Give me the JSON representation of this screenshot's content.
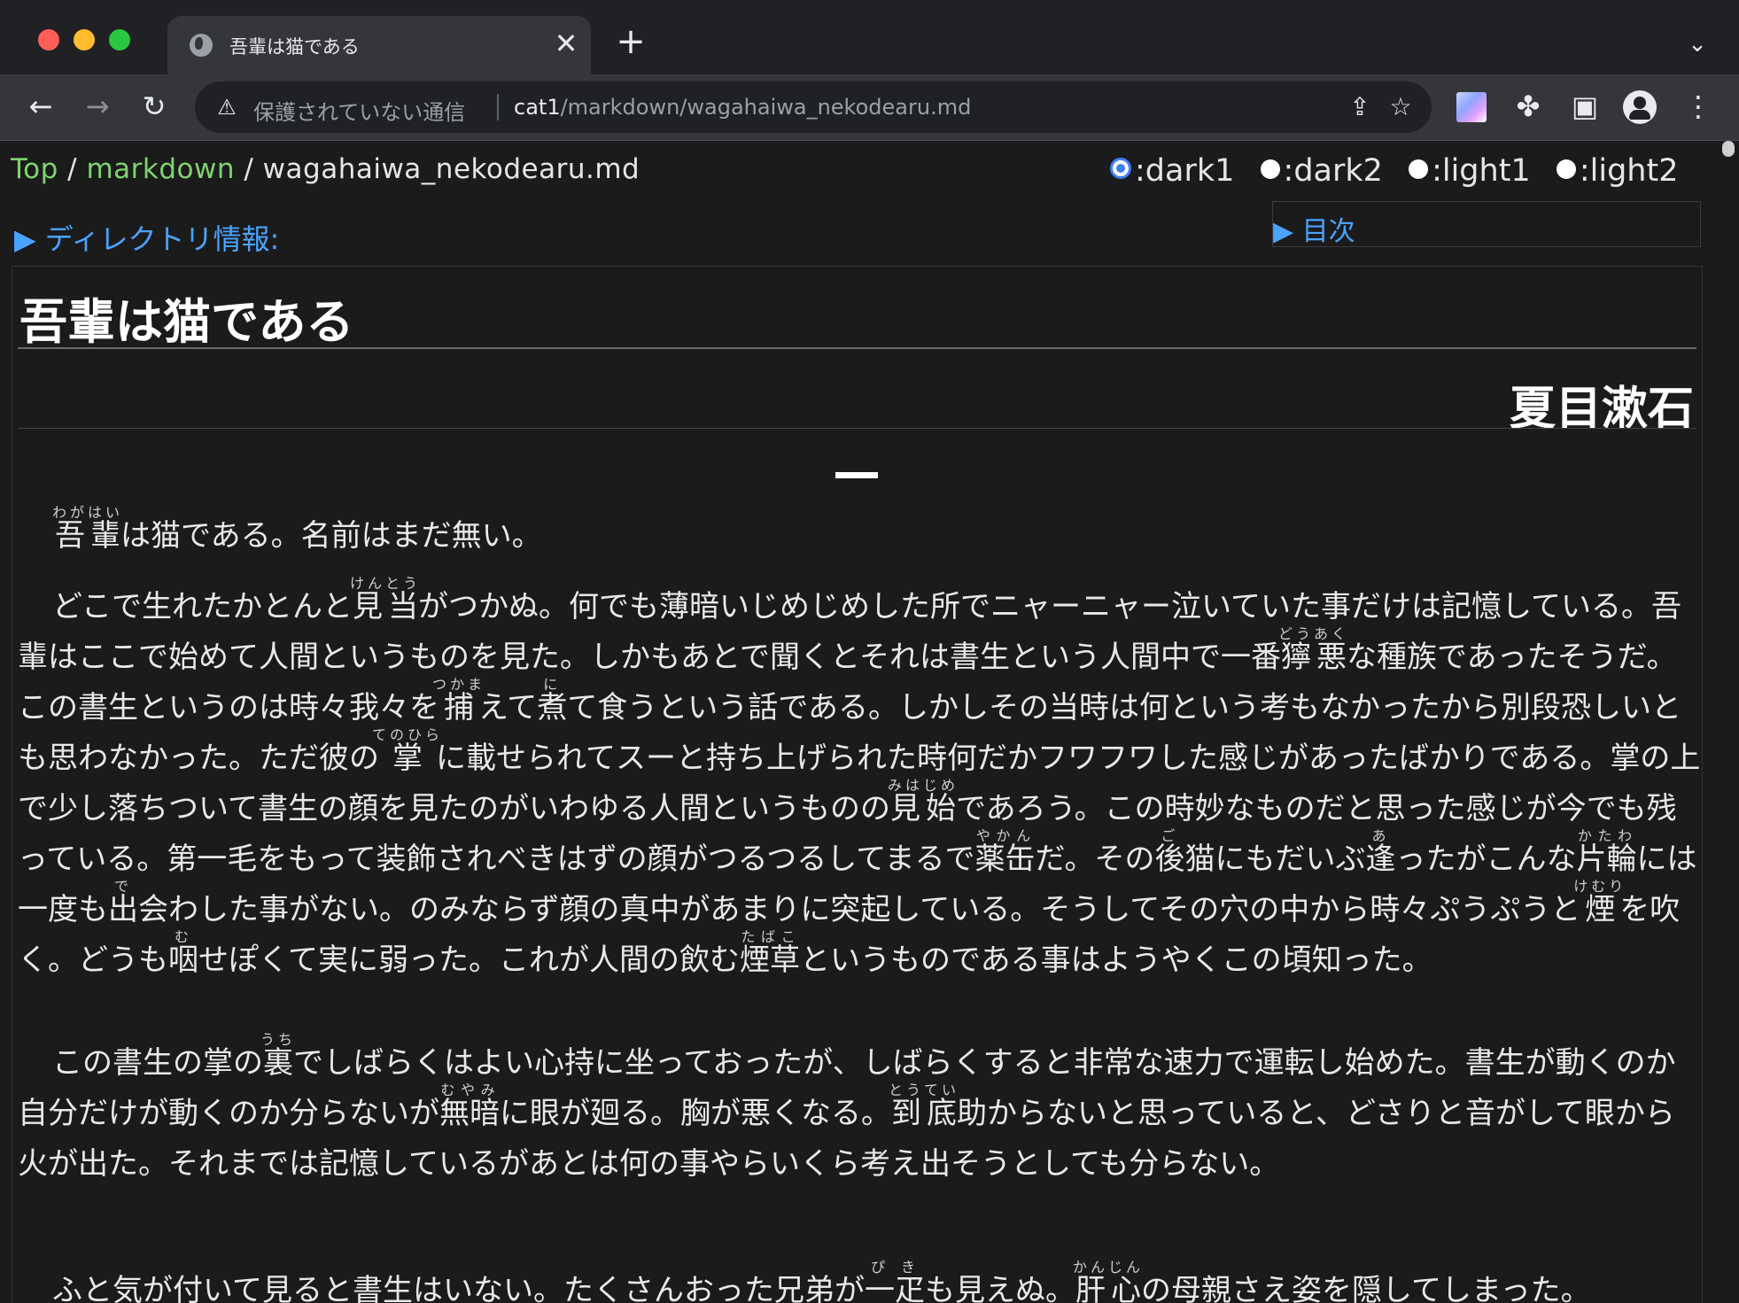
{
  "browser": {
    "tab_title": "吾輩は猫である",
    "tab_close": "✕",
    "new_tab": "+",
    "security_label": "保護されていない通信",
    "url_host": "cat1",
    "url_path": "/markdown/wagahaiwa_nekodearu.md"
  },
  "breadcrumb": {
    "top": "Top",
    "sep1": " / ",
    "folder": "markdown",
    "sep2": " / ",
    "file": "wagahaiwa_nekodearu.md"
  },
  "themes": [
    {
      "label": ":dark1",
      "selected": true
    },
    {
      "label": ":dark2",
      "selected": false
    },
    {
      "label": ":light1",
      "selected": false
    },
    {
      "label": ":light2",
      "selected": false
    }
  ],
  "dir_info": "▶ ディレクトリ情報:",
  "toc": "▶ 目次",
  "document": {
    "title": "吾輩は猫である",
    "author": "夏目漱石",
    "chapter": "一",
    "p1": {
      "r1_base": "吾輩",
      "r1_rt": "わがはい",
      "t1": "は猫である。名前はまだ無い。"
    },
    "p2": {
      "t1": "どこで生れたかとんと",
      "r1_base": "見当",
      "r1_rt": "けんとう",
      "t2": "がつかぬ。何でも薄暗いじめじめした所でニャーニャー泣いていた事だけは記憶している。吾輩はここで始めて人間というものを見た。しかもあとで聞くとそれは書生という人間中で一番",
      "r2_base": "獰悪",
      "r2_rt": "どうあく",
      "t3": "な種族であったそうだ。この書生というのは時々我々を",
      "r3_base": "捕",
      "r3_rt": "つかま",
      "t4": "えて",
      "r4_base": "煮",
      "r4_rt": "に",
      "t5": "て食うという話である。しかしその当時は何という考もなかったから別段恐しいとも思わなかった。ただ彼の",
      "r5_base": "掌",
      "r5_rt": "てのひら",
      "t6": "に載せられてスーと持ち上げられた時何だかフワフワした感じがあったばかりである。掌の上で少し落ちついて書生の顔を見たのがいわゆる人間というものの",
      "r6_base": "見始",
      "r6_rt": "みはじめ",
      "t7": "であろう。この時妙なものだと思った感じが今でも残っている。第一毛をもって装飾されべきはずの顔がつるつるしてまるで",
      "r7_base": "薬缶",
      "r7_rt": "やかん",
      "t8": "だ。その",
      "r8_base": "後",
      "r8_rt": "ご",
      "t9": "猫にもだいぶ",
      "r9_base": "逢",
      "r9_rt": "あ",
      "t10": "ったがこんな",
      "r10_base": "片輪",
      "r10_rt": "かたわ",
      "t11": "には一度も",
      "r11_base": "出",
      "r11_rt": "で",
      "t12": "会わした事がない。のみならず顔の真中があまりに突起している。そうしてその穴の中から時々ぷうぷうと",
      "r12_base": "煙",
      "r12_rt": "けむり",
      "t13": "を吹く。どうも",
      "r13_base": "咽",
      "r13_rt": "む",
      "t14": "せぽくて実に弱った。これが人間の飲む",
      "r14_base": "煙草",
      "r14_rt": "たばこ",
      "t15": "というものである事はようやくこの頃知った。"
    },
    "p3": {
      "t1": "この書生の掌の",
      "r1_base": "裏",
      "r1_rt": "うち",
      "t2": "でしばらくはよい心持に坐っておったが、しばらくすると非常な速力で運転し始めた。書生が動くのか自分だけが動くのか分らないが",
      "r2_base": "無暗",
      "r2_rt": "むやみ",
      "t3": "に眼が廻る。胸が悪くなる。",
      "r3_base": "到底",
      "r3_rt": "とうてい",
      "t4": "助からないと思っていると、どさりと音がして眼から火が出た。それまでは記憶しているがあとは何の事やらいくら考え出そうとしても分らない。"
    },
    "p4": {
      "t1": "ふと気が付いて見ると書生はいない。たくさんおった兄弟が",
      "r1_base": "一疋",
      "r1_rt": "ぴき",
      "t2": "も見えぬ。",
      "r2_base": "肝心",
      "r2_rt": "かんじん",
      "t3": "の母親さえ姿を隠してしまった。"
    }
  }
}
